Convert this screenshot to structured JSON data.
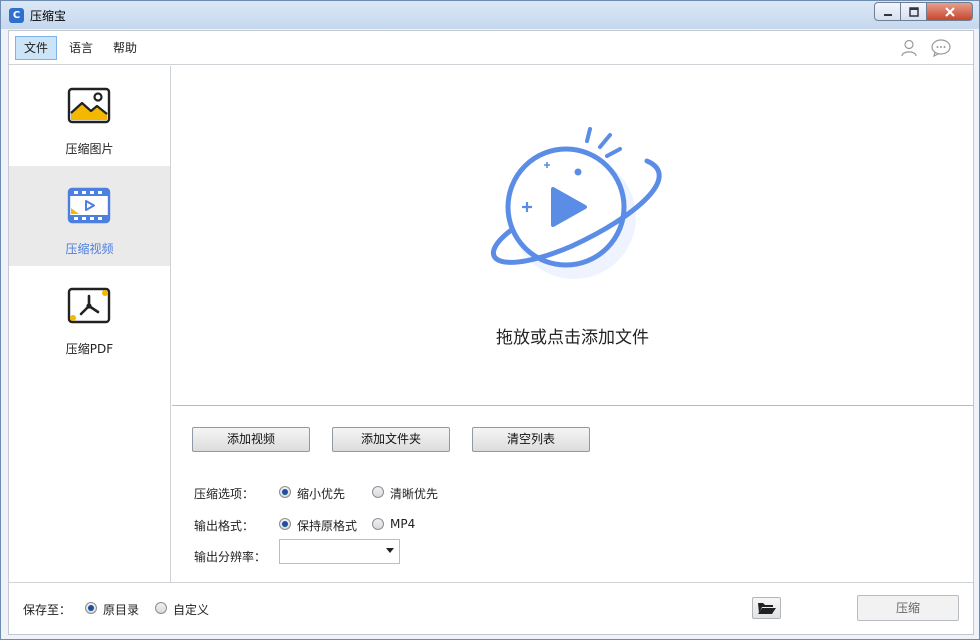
{
  "window": {
    "title": "压缩宝",
    "app_icon_letter": "C"
  },
  "menu": {
    "items": [
      "文件",
      "语言",
      "帮助"
    ]
  },
  "sidebar": {
    "items": [
      {
        "label": "压缩图片",
        "icon": "image-icon"
      },
      {
        "label": "压缩视频",
        "icon": "video-icon",
        "selected": true
      },
      {
        "label": "压缩PDF",
        "icon": "pdf-icon"
      }
    ]
  },
  "dropzone": {
    "text": "拖放或点击添加文件",
    "icon": "planet-play-icon"
  },
  "buttons": {
    "add_video": "添加视频",
    "add_folder": "添加文件夹",
    "clear_list": "清空列表"
  },
  "options": {
    "compress_label": "压缩选项：",
    "compress_opts": [
      "缩小优先",
      "清晰优先"
    ],
    "format_label": "输出格式：",
    "format_opts": [
      "保持原格式",
      "MP4"
    ],
    "resolution_label": "输出分辨率：",
    "resolution_value": ""
  },
  "footer": {
    "save_label": "保存至：",
    "save_opts": [
      "原目录",
      "自定义"
    ],
    "compress_button": "压缩"
  },
  "colors": {
    "accent": "#4d7fe0",
    "icon_yellow": "#f5b800"
  }
}
